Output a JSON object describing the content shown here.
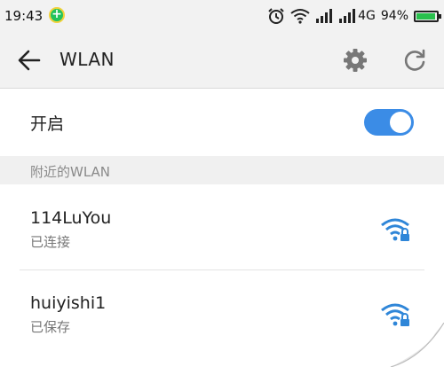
{
  "status_bar": {
    "time": "19:43",
    "network_type": "4G",
    "battery_percent": "94%",
    "battery_level": 0.94,
    "icons": [
      "plus-circle-icon",
      "alarm-icon",
      "wifi-signal-icon",
      "cell-signal-icon",
      "cell-signal-icon",
      "battery-icon"
    ]
  },
  "toolbar": {
    "title": "WLAN",
    "back_icon": "arrow-left-icon",
    "settings_icon": "gear-icon",
    "refresh_icon": "refresh-icon"
  },
  "wifi_toggle": {
    "label": "开启",
    "enabled": true,
    "accent_color": "#3b8ce6"
  },
  "nearby_section": {
    "header": "附近的WLAN",
    "networks": [
      {
        "name": "114LuYou",
        "status": "已连接",
        "secured": true
      },
      {
        "name": "huiyishi1",
        "status": "已保存",
        "secured": true
      }
    ]
  },
  "colors": {
    "wifi_icon": "#2f86d8",
    "battery_fill": "#29c04d"
  }
}
